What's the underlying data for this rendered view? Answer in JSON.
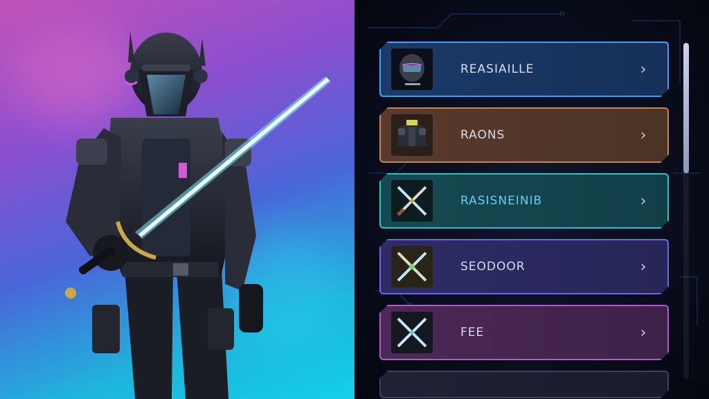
{
  "loadout_list": {
    "items": [
      {
        "label": "REASIAILLE",
        "thumbnail": "helmet-icon",
        "selected": true,
        "accent": "#3fa0ff"
      },
      {
        "label": "RAONS",
        "thumbnail": "armor-icon",
        "selected": false,
        "accent": "#c7865a"
      },
      {
        "label": "RASISNEINIB",
        "thumbnail": "crossed-swords-icon",
        "selected": false,
        "accent": "#2fc3c8"
      },
      {
        "label": "SEODOOR",
        "thumbnail": "crossed-swords-icon",
        "selected": false,
        "accent": "#6f6ad8"
      },
      {
        "label": "FEE",
        "thumbnail": "crossed-swords-icon",
        "selected": false,
        "accent": "#b05cc8"
      }
    ],
    "chevron_glyph": "›"
  },
  "scroll": {
    "position": 0
  },
  "colors": {
    "panel_background": "#080b18",
    "preview_gradient": [
      "#c052b8",
      "#4a66d8",
      "#13d0e8"
    ],
    "sword_glow": "#7fe8ff"
  }
}
